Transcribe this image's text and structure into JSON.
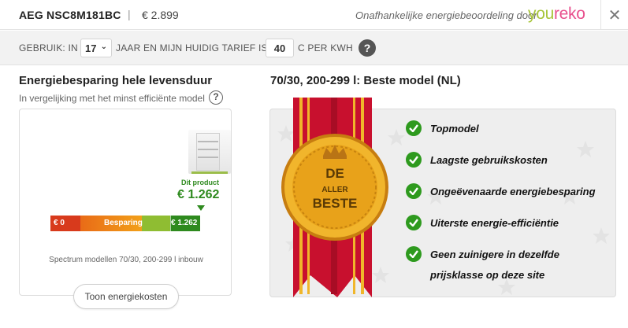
{
  "header": {
    "product_name": "AEG NSC8M181BC",
    "separator": "|",
    "price": "€ 2.899",
    "tagline": "Onafhankelijke energiebeoordeling door",
    "logo_part1": "you",
    "logo_part2": "reko",
    "close_icon": "close-icon"
  },
  "settings": {
    "label_usage": "GEBRUIK: IN",
    "years_value": "17",
    "label_years": "JAAR EN MIJN HUIDIG TARIEF IS",
    "tariff_value": "40",
    "label_tariff": "C PER KWH",
    "help_symbol": "?"
  },
  "left": {
    "title": "Energiebesparing hele levensduur",
    "subtitle": "In vergelijking met het minst efficiënte model",
    "help_symbol": "?",
    "product_label": "Dit product",
    "product_value": "€ 1.262",
    "bar_left": "€ 0",
    "bar_middle": "Besparing",
    "bar_right": "€ 1.262",
    "spectrum_text": "Spectrum modellen 70/30, 200-299 l inbouw",
    "button_label": "Toon energiekosten"
  },
  "right": {
    "title": "70/30, 200-299 l: Beste model (NL)",
    "badge_line1": "DE",
    "badge_line2": "ALLER",
    "badge_line3": "BESTE",
    "features": [
      "Topmodel",
      "Laagste gebruikskosten",
      "Ongeëvenaarde energiebesparing",
      "Uiterste energie-efficiëntie",
      "Geen zuinigere in dezelfde"
    ],
    "feature_last_line2": "prijsklasse op deze site"
  },
  "colors": {
    "accent_green": "#2e8a1e",
    "check_green": "#2e9a1e",
    "ribbon_red": "#c8102e",
    "medal_gold": "#e8a21a",
    "logo_green": "#a8c53a",
    "logo_pink": "#e8508d"
  }
}
